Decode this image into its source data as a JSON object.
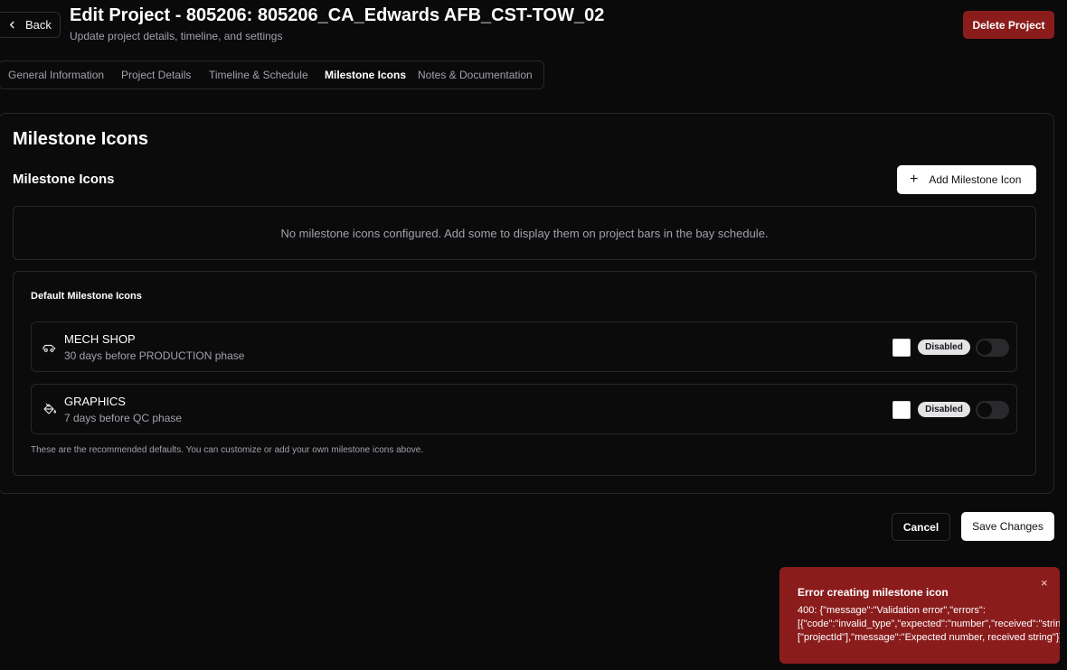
{
  "header": {
    "back_label": "Back",
    "title": "Edit Project - 805206: 805206_CA_Edwards AFB_CST-TOW_02",
    "subtitle": "Update project details, timeline, and settings",
    "delete_label": "Delete Project"
  },
  "tabs": [
    {
      "label": "General Information",
      "active": false
    },
    {
      "label": "Project Details",
      "active": false
    },
    {
      "label": "Timeline & Schedule",
      "active": false
    },
    {
      "label": "Milestone Icons",
      "active": true
    },
    {
      "label": "Notes & Documentation",
      "active": false
    }
  ],
  "card": {
    "title": "Milestone Icons",
    "section_title": "Milestone Icons",
    "add_label": "Add Milestone Icon",
    "empty_text": "No milestone icons configured. Add some to display them on project bars in the bay schedule."
  },
  "defaults": {
    "title": "Default Milestone Icons",
    "items": [
      {
        "icon": "car-icon",
        "name": "MECH SHOP",
        "description": "30 days before PRODUCTION phase",
        "color": "#ffffff",
        "status": "Disabled",
        "enabled": false
      },
      {
        "icon": "paint-bucket-icon",
        "name": "GRAPHICS",
        "description": "7 days before QC phase",
        "color": "#ffffff",
        "status": "Disabled",
        "enabled": false
      }
    ],
    "footnote": "These are the recommended defaults. You can customize or add your own milestone icons above."
  },
  "footer": {
    "cancel_label": "Cancel",
    "save_label": "Save Changes"
  },
  "toast": {
    "title": "Error creating milestone icon",
    "lines": [
      "400: {\"message\":\"Validation error\",\"errors\":",
      "[{\"code\":\"invalid_type\",\"expected\":\"number\",\"received\":\"string\",\"path\":",
      "[\"projectId\"],\"message\":\"Expected number, received string\"}]}"
    ],
    "close_symbol": "×"
  },
  "colors": {
    "background": "#0a0a0b",
    "danger": "#8b1c1c",
    "border": "#27272a",
    "muted_text": "#a1a1aa"
  }
}
